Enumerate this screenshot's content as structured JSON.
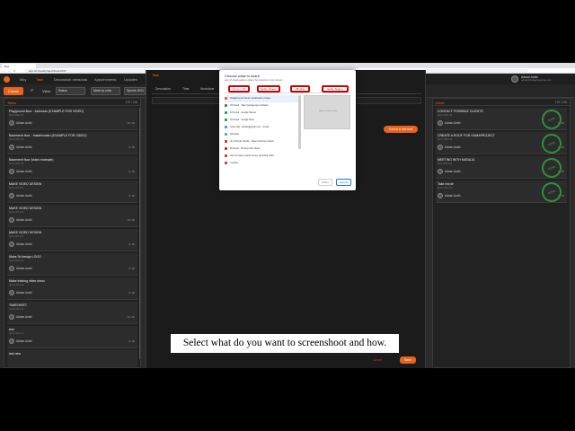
{
  "browser": {
    "tab_title": "Task",
    "address": "app.orf.cloud/project/board/123",
    "back": "←",
    "forward": "→",
    "reload": "⟳"
  },
  "app": {
    "nav": [
      "Mky",
      "Task",
      "Discussion metadata",
      "Appointments",
      "Updates"
    ],
    "active_nav": "Task",
    "user": {
      "name": "Adnan Avdić",
      "email": "adnan@hedgehoggroup.com"
    }
  },
  "toolbar": {
    "create_label": "Create",
    "view_label": "View:",
    "status_value": "Status",
    "mark_value": "Mark by color",
    "sprints_value": "Sprints 2021"
  },
  "left_column": {
    "title": "Tasks",
    "count": "175 / 216",
    "cards": [
      {
        "title": "Playground floor - tochnadu (EXAMPLE FOR VIDEO)",
        "meta": "Sprint 2021 22",
        "owner": "Adnan Avdić",
        "time": "16 / 0h"
      },
      {
        "title": "Basement floor - Installmodeu (EXAMPLE FOR VIDEO)",
        "meta": "Sprint 2021 22",
        "owner": "Adnan Avdić",
        "time": "0 / 0h"
      },
      {
        "title": "Basement floor (video example)",
        "meta": "Sprint 2021 22",
        "owner": "Adnan Avdić",
        "time": "0 / 0h"
      },
      {
        "title": "MAKE VIDEO DESIGN",
        "meta": "Sprint 2021 22",
        "owner": "Adnan Avdić",
        "time": "0 / 0h"
      },
      {
        "title": "MAKE VIDEO DESIGN",
        "meta": "Sprint 2021 22",
        "owner": "Adnan Avdić",
        "time": "16 / 0h"
      },
      {
        "title": "MAKE VIDEO DESIGN",
        "meta": "Sprint 2021 22",
        "owner": "Adnan Avdić",
        "time": "0 / 0h"
      },
      {
        "title": "Make 3d design LOGO",
        "meta": "Sprint 2021 22",
        "owner": "Adnan Avdić",
        "time": "0 / 0h"
      },
      {
        "title": "Make training video intros",
        "meta": "Sprint 2021 22",
        "owner": "Adnan Avdić",
        "time": "0 / 0h"
      },
      {
        "title": "TIMESHEET",
        "meta": "Sprint 2021 22",
        "owner": "Adnan Avdić",
        "time": "72 / 0h"
      },
      {
        "title": "test",
        "meta": "Sprint 2021 22",
        "owner": "Adnan Avdić",
        "time": "0 / 0h"
      },
      {
        "title": "test new",
        "meta": "",
        "owner": "",
        "time": ""
      }
    ]
  },
  "editor": {
    "title": "Task",
    "tabs": [
      "Description",
      "Time",
      "Workdone"
    ],
    "timeline_button": "Tuba to a new task",
    "save_label": "Save",
    "cancel_label": "Cancel"
  },
  "right_column": {
    "title": "Done",
    "count": "175 / 216",
    "stamp": "DONE",
    "cards": [
      {
        "title": "CONTACT POSSIBLE CLIENTS",
        "meta": "Sprint 2021 22",
        "owner": "Adnan Avdić",
        "time": "0 / 0h"
      },
      {
        "title": "CREATE A ROOF FOR GAMAPROJECT",
        "meta": "Sprint 2021 22",
        "owner": "Adnan Avdić",
        "time": "0 / 0h"
      },
      {
        "title": "MEETING WITH MATALIA",
        "meta": "Sprint 2021 22",
        "owner": "Adnan Avdić",
        "time": "0 / 0h"
      },
      {
        "title": "Take movie",
        "meta": "Sprint 2021 22",
        "owner": "Adnan Avdić",
        "time": "0 / 0h"
      }
    ]
  },
  "share_dialog": {
    "title": "Choose what to share",
    "subtitle": "app.orf.cloud wants to share the contents of your screen",
    "tabs": [
      "Chrome Tab",
      "Entire Screen",
      "Window",
      "Entire Screen"
    ],
    "active_tab": 0,
    "items": [
      {
        "label": "Hedgehog orf.cloud / workboard / project",
        "color": "#e8631c"
      },
      {
        "label": "Orf.cloud · Task management software",
        "color": "#2f8f3a"
      },
      {
        "label": "Orf.cloud · Google Sheets",
        "color": "#0f9d58"
      },
      {
        "label": "Orf.cloud · Google Docs",
        "color": "#0f9d58"
      },
      {
        "label": "Inbox (11) · adnan@gmail.com · Gmail",
        "color": "#4285f4"
      },
      {
        "label": "Windows",
        "color": "#5b9bd5"
      },
      {
        "label": "(1) YouTube Studio · Video Channel content",
        "color": "#d32f2f"
      },
      {
        "label": "Pinterest · Pinning Sets Notes",
        "color": "#c62828"
      },
      {
        "label": "How to make a good screen recording video",
        "color": "#d32f2f"
      },
      {
        "label": "Youtube",
        "color": "#d32f2f"
      }
    ],
    "preview_text": "Select a tab to share",
    "share_label": "Share",
    "cancel_label": "Cancel"
  },
  "caption": "Select what do you want to screenshoot and how."
}
